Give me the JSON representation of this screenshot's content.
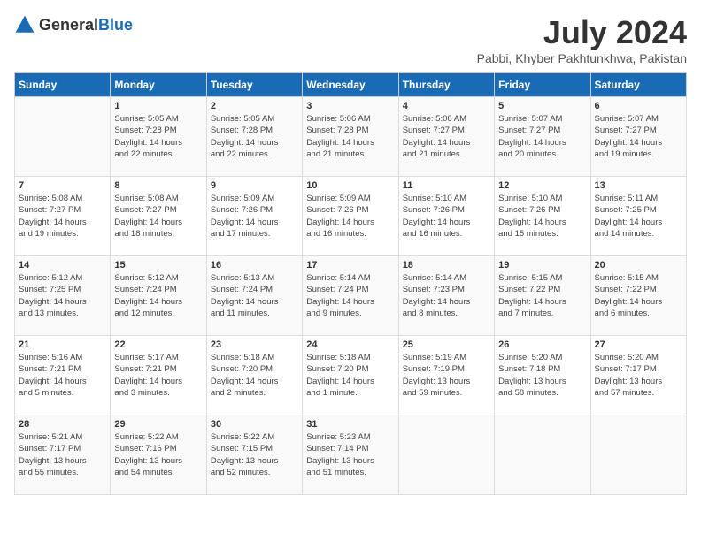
{
  "header": {
    "logo_general": "General",
    "logo_blue": "Blue",
    "month": "July 2024",
    "location": "Pabbi, Khyber Pakhtunkhwa, Pakistan"
  },
  "days_of_week": [
    "Sunday",
    "Monday",
    "Tuesday",
    "Wednesday",
    "Thursday",
    "Friday",
    "Saturday"
  ],
  "weeks": [
    [
      {
        "day": "",
        "info": ""
      },
      {
        "day": "1",
        "info": "Sunrise: 5:05 AM\nSunset: 7:28 PM\nDaylight: 14 hours\nand 22 minutes."
      },
      {
        "day": "2",
        "info": "Sunrise: 5:05 AM\nSunset: 7:28 PM\nDaylight: 14 hours\nand 22 minutes."
      },
      {
        "day": "3",
        "info": "Sunrise: 5:06 AM\nSunset: 7:28 PM\nDaylight: 14 hours\nand 21 minutes."
      },
      {
        "day": "4",
        "info": "Sunrise: 5:06 AM\nSunset: 7:27 PM\nDaylight: 14 hours\nand 21 minutes."
      },
      {
        "day": "5",
        "info": "Sunrise: 5:07 AM\nSunset: 7:27 PM\nDaylight: 14 hours\nand 20 minutes."
      },
      {
        "day": "6",
        "info": "Sunrise: 5:07 AM\nSunset: 7:27 PM\nDaylight: 14 hours\nand 19 minutes."
      }
    ],
    [
      {
        "day": "7",
        "info": "Sunrise: 5:08 AM\nSunset: 7:27 PM\nDaylight: 14 hours\nand 19 minutes."
      },
      {
        "day": "8",
        "info": "Sunrise: 5:08 AM\nSunset: 7:27 PM\nDaylight: 14 hours\nand 18 minutes."
      },
      {
        "day": "9",
        "info": "Sunrise: 5:09 AM\nSunset: 7:26 PM\nDaylight: 14 hours\nand 17 minutes."
      },
      {
        "day": "10",
        "info": "Sunrise: 5:09 AM\nSunset: 7:26 PM\nDaylight: 14 hours\nand 16 minutes."
      },
      {
        "day": "11",
        "info": "Sunrise: 5:10 AM\nSunset: 7:26 PM\nDaylight: 14 hours\nand 16 minutes."
      },
      {
        "day": "12",
        "info": "Sunrise: 5:10 AM\nSunset: 7:26 PM\nDaylight: 14 hours\nand 15 minutes."
      },
      {
        "day": "13",
        "info": "Sunrise: 5:11 AM\nSunset: 7:25 PM\nDaylight: 14 hours\nand 14 minutes."
      }
    ],
    [
      {
        "day": "14",
        "info": "Sunrise: 5:12 AM\nSunset: 7:25 PM\nDaylight: 14 hours\nand 13 minutes."
      },
      {
        "day": "15",
        "info": "Sunrise: 5:12 AM\nSunset: 7:24 PM\nDaylight: 14 hours\nand 12 minutes."
      },
      {
        "day": "16",
        "info": "Sunrise: 5:13 AM\nSunset: 7:24 PM\nDaylight: 14 hours\nand 11 minutes."
      },
      {
        "day": "17",
        "info": "Sunrise: 5:14 AM\nSunset: 7:24 PM\nDaylight: 14 hours\nand 9 minutes."
      },
      {
        "day": "18",
        "info": "Sunrise: 5:14 AM\nSunset: 7:23 PM\nDaylight: 14 hours\nand 8 minutes."
      },
      {
        "day": "19",
        "info": "Sunrise: 5:15 AM\nSunset: 7:22 PM\nDaylight: 14 hours\nand 7 minutes."
      },
      {
        "day": "20",
        "info": "Sunrise: 5:15 AM\nSunset: 7:22 PM\nDaylight: 14 hours\nand 6 minutes."
      }
    ],
    [
      {
        "day": "21",
        "info": "Sunrise: 5:16 AM\nSunset: 7:21 PM\nDaylight: 14 hours\nand 5 minutes."
      },
      {
        "day": "22",
        "info": "Sunrise: 5:17 AM\nSunset: 7:21 PM\nDaylight: 14 hours\nand 3 minutes."
      },
      {
        "day": "23",
        "info": "Sunrise: 5:18 AM\nSunset: 7:20 PM\nDaylight: 14 hours\nand 2 minutes."
      },
      {
        "day": "24",
        "info": "Sunrise: 5:18 AM\nSunset: 7:20 PM\nDaylight: 14 hours\nand 1 minute."
      },
      {
        "day": "25",
        "info": "Sunrise: 5:19 AM\nSunset: 7:19 PM\nDaylight: 13 hours\nand 59 minutes."
      },
      {
        "day": "26",
        "info": "Sunrise: 5:20 AM\nSunset: 7:18 PM\nDaylight: 13 hours\nand 58 minutes."
      },
      {
        "day": "27",
        "info": "Sunrise: 5:20 AM\nSunset: 7:17 PM\nDaylight: 13 hours\nand 57 minutes."
      }
    ],
    [
      {
        "day": "28",
        "info": "Sunrise: 5:21 AM\nSunset: 7:17 PM\nDaylight: 13 hours\nand 55 minutes."
      },
      {
        "day": "29",
        "info": "Sunrise: 5:22 AM\nSunset: 7:16 PM\nDaylight: 13 hours\nand 54 minutes."
      },
      {
        "day": "30",
        "info": "Sunrise: 5:22 AM\nSunset: 7:15 PM\nDaylight: 13 hours\nand 52 minutes."
      },
      {
        "day": "31",
        "info": "Sunrise: 5:23 AM\nSunset: 7:14 PM\nDaylight: 13 hours\nand 51 minutes."
      },
      {
        "day": "",
        "info": ""
      },
      {
        "day": "",
        "info": ""
      },
      {
        "day": "",
        "info": ""
      }
    ]
  ]
}
